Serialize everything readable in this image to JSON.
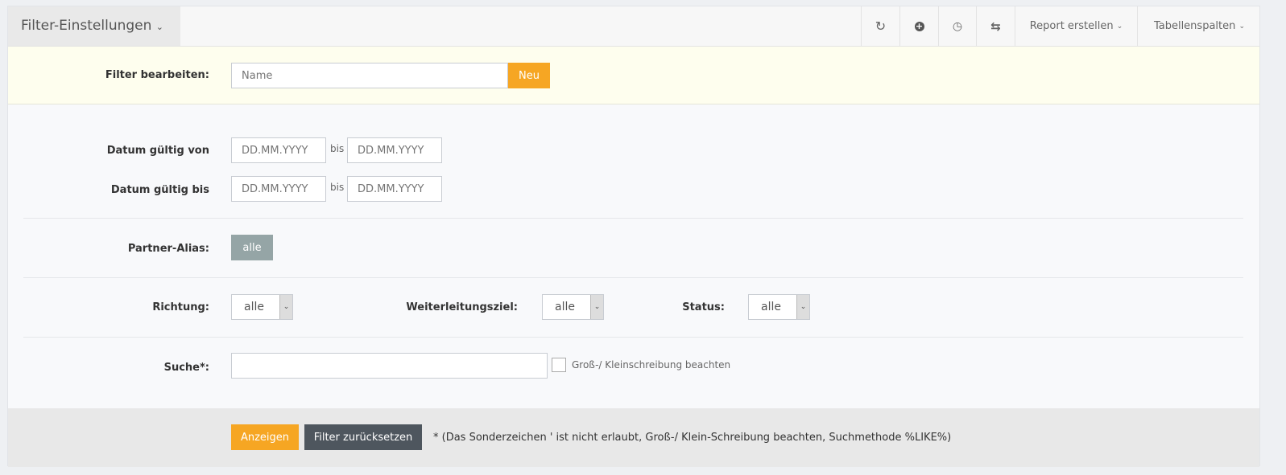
{
  "header": {
    "title": "Filter-Einstellungen",
    "icons": [
      "refresh-icon",
      "plus-circle-icon",
      "clock-icon",
      "retweet-icon"
    ],
    "report_label": "Report erstellen",
    "columns_label": "Tabellenspalten"
  },
  "filter_edit": {
    "label": "Filter bearbeiten:",
    "name_placeholder": "Name",
    "new_label": "Neu"
  },
  "dates": {
    "valid_from_label": "Datum gültig von",
    "valid_to_label": "Datum gültig bis",
    "placeholder": "DD.MM.YYYY",
    "bis": "bis"
  },
  "partner": {
    "label": "Partner-Alias:",
    "button": "alle"
  },
  "selects": {
    "richtung_label": "Richtung:",
    "richtung_value": "alle",
    "ziel_label": "Weiterleitungsziel:",
    "ziel_value": "alle",
    "status_label": "Status:",
    "status_value": "alle"
  },
  "search": {
    "label": "Suche*:",
    "value": "",
    "case_label": "Groß-/ Kleinschreibung beachten",
    "case_checked": false
  },
  "footer": {
    "show_label": "Anzeigen",
    "reset_label": "Filter zurücksetzen",
    "note": "* (Das Sonderzeichen ' ist nicht erlaubt, Groß-/ Klein-Schreibung beachten, Suchmethode %LIKE%)"
  },
  "colors": {
    "accent": "#f6a623",
    "dark": "#4e565e",
    "partner": "#95a5a6"
  }
}
